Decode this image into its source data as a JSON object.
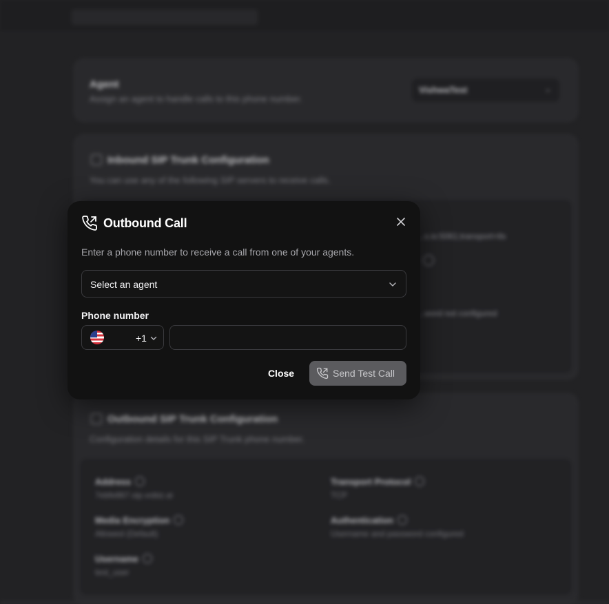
{
  "background": {
    "agent_card": {
      "title": "Agent",
      "subtitle": "Assign an agent to handle calls to this phone number.",
      "selected_agent": "VishwaTest"
    },
    "inbound_card": {
      "title": "Inbound SIP Trunk Configuration",
      "subtitle": "You can use any of the following SIP servers to receive calls.",
      "peek_server": "...s.io:5061;transport=tls",
      "peek_auth": "...word not configured"
    },
    "outbound_card": {
      "title": "Outbound SIP Trunk Configuration",
      "subtitle": "Configuration details for this SIP Trunk phone number.",
      "fields": {
        "address_label": "Address",
        "address_value": "7ebfe867.sip.vobiz.ai",
        "transport_label": "Transport Protocol",
        "transport_value": "TCP",
        "encryption_label": "Media Encryption",
        "encryption_value": "Allowed (Default)",
        "authentication_label": "Authentication",
        "authentication_value": "Username and password configured",
        "username_label": "Username",
        "username_value": "test_user"
      }
    }
  },
  "modal": {
    "title": "Outbound Call",
    "description": "Enter a phone number to receive a call from one of your agents.",
    "agent_select_placeholder": "Select an agent",
    "phone_label": "Phone number",
    "country_code": "+1",
    "phone_value": "",
    "close_label": "Close",
    "send_label": "Send Test Call"
  },
  "colors": {
    "modal_bg": "#121212",
    "page_bg": "#222224",
    "card_bg": "#2b2b2e",
    "send_button_disabled": "#5b5b5e"
  },
  "icons": {
    "modal_title_icon": "phone-outgoing-icon",
    "close": "close-icon",
    "select_chevron": "chevron-down-icon",
    "country_flag": "us-flag-icon"
  }
}
